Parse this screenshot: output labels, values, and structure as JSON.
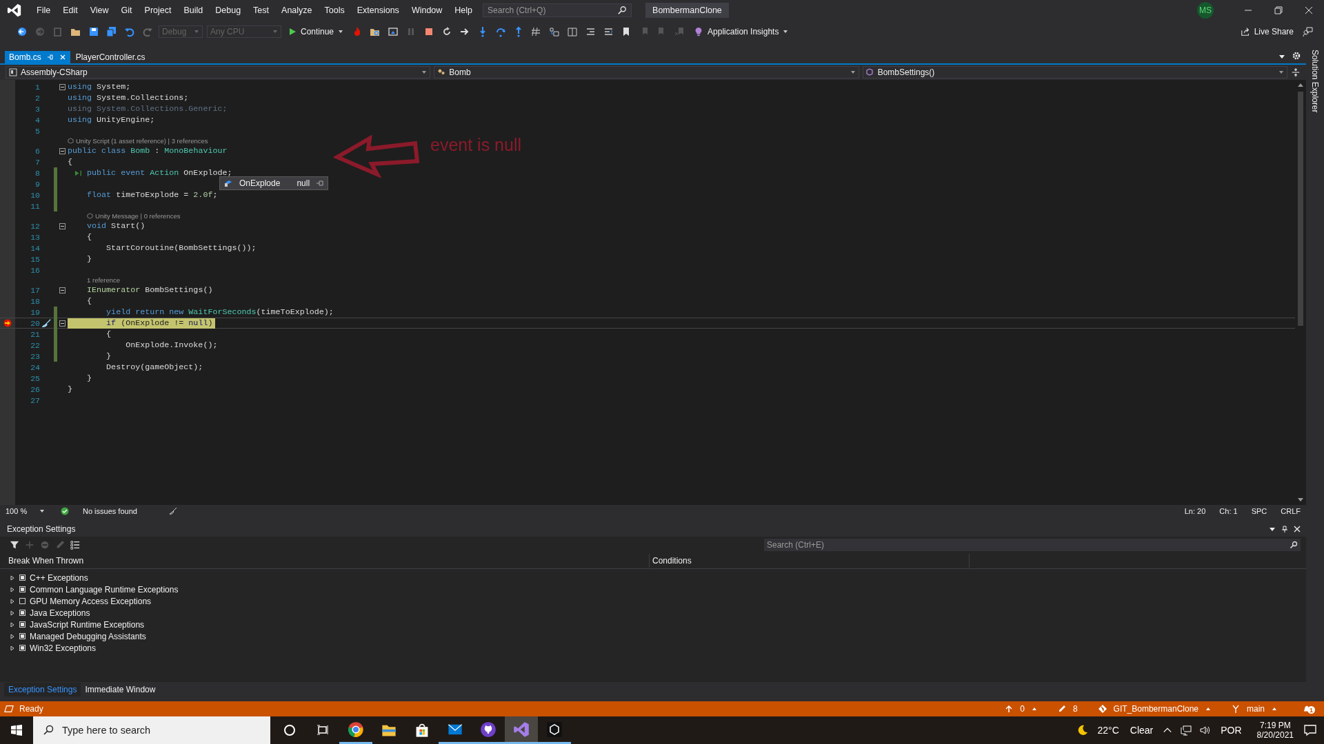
{
  "title_bar": {
    "menu": [
      "File",
      "Edit",
      "View",
      "Git",
      "Project",
      "Build",
      "Debug",
      "Test",
      "Analyze",
      "Tools",
      "Extensions",
      "Window",
      "Help"
    ],
    "search_placeholder": "Search (Ctrl+Q)",
    "solution": "BombermanClone",
    "account": "MS"
  },
  "toolbar": {
    "configuration": "Debug",
    "platform": "Any CPU",
    "continue": "Continue",
    "insights": "Application Insights",
    "live_share": "Live Share"
  },
  "tabs": [
    {
      "label": "Bomb.cs",
      "selected": true
    },
    {
      "label": "PlayerController.cs",
      "selected": false
    }
  ],
  "side_tab": "Solution Explorer",
  "nav_bar": [
    "Assembly-CSharp",
    "Bomb",
    "BombSettings()"
  ],
  "code_lines": [
    {
      "n": "1",
      "fold": true,
      "changed": false,
      "current": false,
      "breakpoint": false,
      "run_glyph": false,
      "tokens": [
        {
          "kind": "kw",
          "text": "using"
        },
        {
          "kind": "plain",
          "text": " System;"
        }
      ]
    },
    {
      "n": "2",
      "fold": false,
      "changed": false,
      "current": false,
      "breakpoint": false,
      "run_glyph": false,
      "tokens": [
        {
          "kind": "kw",
          "text": "using"
        },
        {
          "kind": "plain",
          "text": " System.Collections;"
        }
      ]
    },
    {
      "n": "3",
      "fold": false,
      "changed": false,
      "current": false,
      "breakpoint": false,
      "run_glyph": false,
      "tokens": [
        {
          "kind": "faded",
          "text": "using System.Collections.Generic;"
        }
      ]
    },
    {
      "n": "4",
      "fold": false,
      "changed": false,
      "current": false,
      "breakpoint": false,
      "run_glyph": false,
      "tokens": [
        {
          "kind": "kw",
          "text": "using"
        },
        {
          "kind": "plain",
          "text": " UnityEngine;"
        }
      ]
    },
    {
      "n": "5",
      "fold": false,
      "changed": false,
      "current": false,
      "breakpoint": false,
      "run_glyph": false
    },
    {
      "n": "6",
      "fold": true,
      "changed": false,
      "current": false,
      "breakpoint": false,
      "run_glyph": false,
      "lens": {
        "icon": true,
        "text": "Unity Script (1 asset reference) | 3 references"
      },
      "tokens": [
        {
          "kind": "kw",
          "text": "public class "
        },
        {
          "kind": "type",
          "text": "Bomb"
        },
        {
          "kind": "plain",
          "text": " : "
        },
        {
          "kind": "type",
          "text": "MonoBehaviour"
        }
      ]
    },
    {
      "n": "7",
      "fold": false,
      "changed": false,
      "current": false,
      "breakpoint": false,
      "run_glyph": false,
      "tokens": [
        {
          "kind": "plain",
          "text": "{"
        }
      ]
    },
    {
      "n": "8",
      "fold": false,
      "changed": true,
      "current": false,
      "breakpoint": false,
      "run_glyph": true,
      "tokens": [
        {
          "kind": "kw",
          "text": "    public event "
        },
        {
          "kind": "type",
          "text": "Action"
        },
        {
          "kind": "plain",
          "text": " OnExplode;"
        }
      ]
    },
    {
      "n": "9",
      "fold": false,
      "changed": true,
      "current": false,
      "breakpoint": false,
      "run_glyph": false
    },
    {
      "n": "10",
      "fold": false,
      "changed": true,
      "current": false,
      "breakpoint": false,
      "run_glyph": false,
      "tokens": [
        {
          "kind": "kw",
          "text": "    float"
        },
        {
          "kind": "plain",
          "text": " timeToExplode = "
        },
        {
          "kind": "num",
          "text": "2.0f"
        },
        {
          "kind": "plain",
          "text": ";"
        }
      ]
    },
    {
      "n": "11",
      "fold": false,
      "changed": true,
      "current": false,
      "breakpoint": false,
      "run_glyph": false
    },
    {
      "n": "12",
      "fold": true,
      "changed": false,
      "current": false,
      "breakpoint": false,
      "run_glyph": false,
      "lens": {
        "icon": true,
        "text": "Unity Message | 0 references"
      },
      "tokens": [
        {
          "kind": "kw",
          "text": "    void"
        },
        {
          "kind": "plain",
          "text": " Start()"
        }
      ]
    },
    {
      "n": "13",
      "fold": false,
      "changed": false,
      "current": false,
      "breakpoint": false,
      "run_glyph": false,
      "tokens": [
        {
          "kind": "plain",
          "text": "    {"
        }
      ]
    },
    {
      "n": "14",
      "fold": false,
      "changed": false,
      "current": false,
      "breakpoint": false,
      "run_glyph": false,
      "tokens": [
        {
          "kind": "plain",
          "text": "        StartCoroutine(BombSettings());"
        }
      ]
    },
    {
      "n": "15",
      "fold": false,
      "changed": false,
      "current": false,
      "breakpoint": false,
      "run_glyph": false,
      "tokens": [
        {
          "kind": "plain",
          "text": "    }"
        }
      ]
    },
    {
      "n": "16",
      "fold": false,
      "changed": false,
      "current": false,
      "breakpoint": false,
      "run_glyph": false
    },
    {
      "n": "17",
      "fold": true,
      "changed": false,
      "current": false,
      "breakpoint": false,
      "run_glyph": false,
      "lens": {
        "icon": false,
        "text": "1 reference"
      },
      "tokens": [
        {
          "kind": "iface",
          "text": "    IEnumerator"
        },
        {
          "kind": "plain",
          "text": " BombSettings()"
        }
      ]
    },
    {
      "n": "18",
      "fold": false,
      "changed": false,
      "current": false,
      "breakpoint": false,
      "run_glyph": false,
      "tokens": [
        {
          "kind": "plain",
          "text": "    {"
        }
      ]
    },
    {
      "n": "19",
      "fold": false,
      "changed": true,
      "current": false,
      "breakpoint": false,
      "run_glyph": false,
      "tokens": [
        {
          "kind": "kw",
          "text": "        yield return new "
        },
        {
          "kind": "type",
          "text": "WaitForSeconds"
        },
        {
          "kind": "plain",
          "text": "(timeToExplode);"
        }
      ]
    },
    {
      "n": "20",
      "fold": true,
      "changed": true,
      "current": true,
      "breakpoint": true,
      "run_glyph": false,
      "tokens": [
        {
          "kind": "kw",
          "text": "        if"
        },
        {
          "kind": "plain",
          "text": " (OnExplode != "
        },
        {
          "kind": "kw",
          "text": "null"
        },
        {
          "kind": "plain",
          "text": ")"
        }
      ]
    },
    {
      "n": "21",
      "fold": false,
      "changed": true,
      "current": false,
      "breakpoint": false,
      "run_glyph": false,
      "tokens": [
        {
          "kind": "plain",
          "text": "        {"
        }
      ]
    },
    {
      "n": "22",
      "fold": false,
      "changed": true,
      "current": false,
      "breakpoint": false,
      "run_glyph": false,
      "tokens": [
        {
          "kind": "plain",
          "text": "            OnExplode.Invoke();"
        }
      ]
    },
    {
      "n": "23",
      "fold": false,
      "changed": true,
      "current": false,
      "breakpoint": false,
      "run_glyph": false,
      "tokens": [
        {
          "kind": "plain",
          "text": "        }"
        }
      ]
    },
    {
      "n": "24",
      "fold": false,
      "changed": false,
      "current": false,
      "breakpoint": false,
      "run_glyph": false,
      "tokens": [
        {
          "kind": "plain",
          "text": "        Destroy(gameObject);"
        }
      ]
    },
    {
      "n": "25",
      "fold": false,
      "changed": false,
      "current": false,
      "breakpoint": false,
      "run_glyph": false,
      "tokens": [
        {
          "kind": "plain",
          "text": "    }"
        }
      ]
    },
    {
      "n": "26",
      "fold": false,
      "changed": false,
      "current": false,
      "breakpoint": false,
      "run_glyph": false,
      "tokens": [
        {
          "kind": "plain",
          "text": "}"
        }
      ]
    },
    {
      "n": "27",
      "fold": false,
      "changed": false,
      "current": false,
      "breakpoint": false,
      "run_glyph": false
    }
  ],
  "datatip": {
    "name": "OnExplode",
    "value": "null"
  },
  "annotation": {
    "text": "event is null"
  },
  "editor_status": {
    "zoom": "100 %",
    "issues": "No issues found",
    "line": "Ln: 20",
    "column": "Ch: 1",
    "whitespace": "SPC",
    "line_ending": "CRLF"
  },
  "exception_settings": {
    "title": "Exception Settings",
    "search_placeholder": "Search (Ctrl+E)",
    "columns": [
      "Break When Thrown",
      "Conditions"
    ],
    "rows": [
      {
        "label": "C++ Exceptions",
        "checked": true
      },
      {
        "label": "Common Language Runtime Exceptions",
        "checked": true
      },
      {
        "label": "GPU Memory Access Exceptions",
        "checked": false
      },
      {
        "label": "Java Exceptions",
        "checked": true
      },
      {
        "label": "JavaScript Runtime Exceptions",
        "checked": true
      },
      {
        "label": "Managed Debugging Assistants",
        "checked": true
      },
      {
        "label": "Win32 Exceptions",
        "checked": true
      }
    ]
  },
  "panel_tabs": [
    {
      "label": "Exception Settings",
      "selected": true
    },
    {
      "label": "Immediate Window",
      "selected": false
    }
  ],
  "status_bar": {
    "state": "Ready",
    "push_count": "0",
    "changes": "8",
    "repository": "GIT_BombermanClone",
    "branch": "main",
    "notifications": "1"
  },
  "taskbar": {
    "search_placeholder": "Type here to search",
    "temperature": "22°C",
    "weather": "Clear",
    "language": "POR",
    "time": "7:19 PM",
    "date": "8/20/2021"
  }
}
